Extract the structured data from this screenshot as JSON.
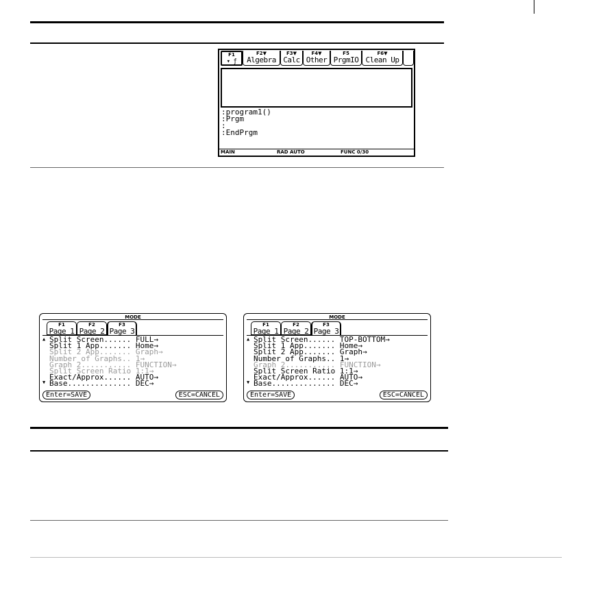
{
  "top_screen": {
    "toolbar": [
      {
        "fkey": "F1",
        "label": ""
      },
      {
        "fkey": "F2▼",
        "label": "Algebra"
      },
      {
        "fkey": "F3▼",
        "label": "Calc"
      },
      {
        "fkey": "F4▼",
        "label": "Other"
      },
      {
        "fkey": "F5",
        "label": "PrgmIO"
      },
      {
        "fkey": "F6▼",
        "label": "Clean Up"
      }
    ],
    "program_lines": [
      ":program1()",
      ":Prgm",
      ":",
      ":EndPrgm"
    ],
    "status": {
      "main": "MAIN",
      "mode": "RAD AUTO",
      "func": "FUNC 0/30"
    }
  },
  "mode_left": {
    "title": "MODE",
    "tabs": [
      {
        "fkey": "F1",
        "label": "Page 1"
      },
      {
        "fkey": "F2",
        "label": "Page 2"
      },
      {
        "fkey": "F3",
        "label": "Page 3"
      }
    ],
    "rows": [
      {
        "name": "Split Screen......",
        "value": "FULL→",
        "dim": false
      },
      {
        "name": "Split 1 App.......",
        "value": "Home→",
        "dim": false
      },
      {
        "name": "Split 2 App.......",
        "value": "Graph→",
        "dim": true
      },
      {
        "name": "Number of Graphs..",
        "value": "1→",
        "dim": true
      },
      {
        "name": "Graph 2...........",
        "value": "FUNCTION→",
        "dim": true
      },
      {
        "name": "Split Screen Ratio",
        "value": "1:1→",
        "dim": true
      },
      {
        "name": "Exact/Approx......",
        "value": "AUTO→",
        "dim": false
      },
      {
        "name": "Base..............",
        "value": "DEC→",
        "dim": false
      }
    ],
    "enter_label": "Enter=SAVE",
    "esc_label": "ESC=CANCEL"
  },
  "mode_right": {
    "title": "MODE",
    "tabs": [
      {
        "fkey": "F1",
        "label": "Page 1"
      },
      {
        "fkey": "F2",
        "label": "Page 2"
      },
      {
        "fkey": "F3",
        "label": "Page 3"
      }
    ],
    "rows": [
      {
        "name": "Split Screen......",
        "value": "TOP-BOTTOM→",
        "dim": false
      },
      {
        "name": "Split 1 App.......",
        "value": "Home→",
        "dim": false
      },
      {
        "name": "Split 2 App.......",
        "value": "Graph→",
        "dim": false
      },
      {
        "name": "Number of Graphs..",
        "value": "1→",
        "dim": false
      },
      {
        "name": "Graph 2...........",
        "value": "FUNCTION→",
        "dim": true
      },
      {
        "name": "Split Screen Ratio",
        "value": "1:1→",
        "dim": false
      },
      {
        "name": "Exact/Approx......",
        "value": "AUTO→",
        "dim": false
      },
      {
        "name": "Base..............",
        "value": "DEC→",
        "dim": false
      }
    ],
    "enter_label": "Enter=SAVE",
    "esc_label": "ESC=CANCEL"
  }
}
